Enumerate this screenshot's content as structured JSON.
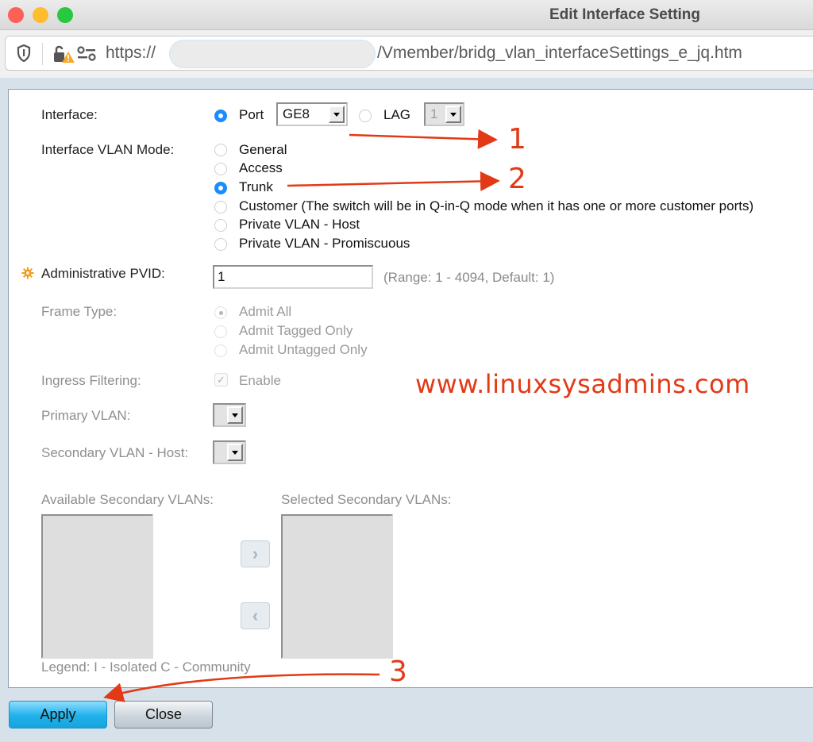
{
  "window": {
    "title": "Edit Interface Setting"
  },
  "urlbar": {
    "url_prefix": "https://",
    "url_suffix": "/Vmember/bridg_vlan_interfaceSettings_e_jq.htm",
    "icons": [
      "shield-icon",
      "lock-warning-icon",
      "permissions-icon"
    ]
  },
  "form": {
    "interface": {
      "label": "Interface:",
      "port_label": "Port",
      "port_selected": true,
      "port_value": "GE8",
      "lag_label": "LAG",
      "lag_selected": false,
      "lag_value": "1"
    },
    "vlan_mode": {
      "label": "Interface VLAN Mode:",
      "options": [
        {
          "label": "General",
          "selected": false
        },
        {
          "label": "Access",
          "selected": false
        },
        {
          "label": "Trunk",
          "selected": true
        },
        {
          "label": "Customer (The switch will be in Q-in-Q mode when it has one or more customer ports)",
          "selected": false
        },
        {
          "label": "Private VLAN - Host",
          "selected": false
        },
        {
          "label": "Private VLAN - Promiscuous",
          "selected": false
        }
      ]
    },
    "pvid": {
      "label": "Administrative PVID:",
      "value": "1",
      "hint": "(Range: 1 - 4094, Default: 1)",
      "required_icon": "gear-required-icon"
    },
    "frame_type": {
      "label": "Frame Type:",
      "options": [
        {
          "label": "Admit All",
          "selected": true
        },
        {
          "label": "Admit Tagged Only",
          "selected": false
        },
        {
          "label": "Admit Untagged Only",
          "selected": false
        }
      ]
    },
    "ingress_filtering": {
      "label": "Ingress Filtering:",
      "checkbox_label": "Enable",
      "checked": true
    },
    "primary_vlan": {
      "label": "Primary VLAN:",
      "value": ""
    },
    "secondary_vlan_host": {
      "label": "Secondary VLAN - Host:",
      "value": ""
    },
    "available_secondary": {
      "label": "Available Secondary VLANs:",
      "items": []
    },
    "selected_secondary": {
      "label": "Selected Secondary VLANs:",
      "items": []
    },
    "move_right_symbol": "›",
    "move_left_symbol": "‹",
    "legend": "Legend: I - Isolated C - Community"
  },
  "buttons": {
    "apply": "Apply",
    "close": "Close"
  },
  "annotations": {
    "watermark": "www.linuxsysadmins.com",
    "markers": [
      "1",
      "2",
      "3"
    ],
    "color": "#e23a17"
  }
}
